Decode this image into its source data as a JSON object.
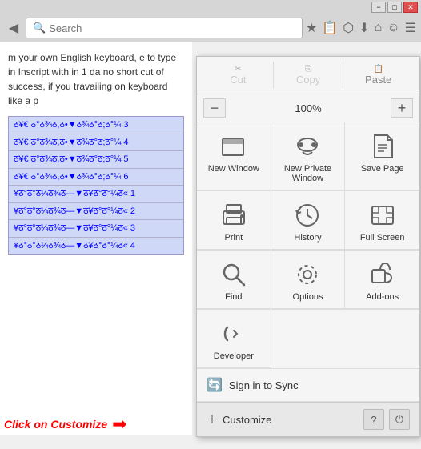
{
  "titlebar": {
    "minimize_label": "−",
    "maximize_label": "□",
    "close_label": "✕"
  },
  "navbar": {
    "back_icon": "◀",
    "search_placeholder": "Search"
  },
  "page": {
    "text": "m your own English keyboard, e to type in Inscript with in 1 da no short cut of success, if you travailing on keyboard like a p",
    "links": [
      "ठ¥€ ठ°ठ¾ठ,ठ•▼ठ¾ठ°ठ°ठ;ठ°¼ 3",
      "ठ¥€ ठ°ठ¾ठ,ठ•▼ठ¾ठ°ठ°ठ;ठ°¼ 4",
      "ठ¥€ ठ°ठ¾ठ,ठ•▼ठ¾ठ°ठ°ठ;ठ°¼ 5",
      "ठ¥€ ठ°ठ¾ठ,ठ•▼ठ¾ठ°ठ°ठ;ठ°¼ 6",
      "¥ठ°ठ°ठ¼ठ¾ठ—▼ठ¥ठ°ठ°¼ठ« 1",
      "¥ठ°ठ°ठ¼ठ¾ठ—▼ठ¥ठ°ठ°¼ठ« 2",
      "¥ठ°ठ°ठ¼ठ¾ठ—▼ठ¥ठ°ठ°¼ठ« 3",
      "¥ठ°ठ°ठ¼ठ¾ठ—▼ठ¥ठ°ठ°¼ठ« 4"
    ]
  },
  "menu": {
    "cut_label": "Cut",
    "copy_label": "Copy",
    "paste_label": "Paste",
    "zoom_value": "100%",
    "new_window_label": "New Window",
    "new_private_window_label": "New Private Window",
    "save_page_label": "Save Page",
    "print_label": "Print",
    "history_label": "History",
    "full_screen_label": "Full Screen",
    "find_label": "Find",
    "options_label": "Options",
    "addons_label": "Add-ons",
    "developer_label": "Developer",
    "sign_in_label": "Sign in to Sync",
    "customize_label": "Customize",
    "help_label": "?",
    "power_label": "⏻"
  },
  "annotation": {
    "click_text": "Click on Customize"
  }
}
